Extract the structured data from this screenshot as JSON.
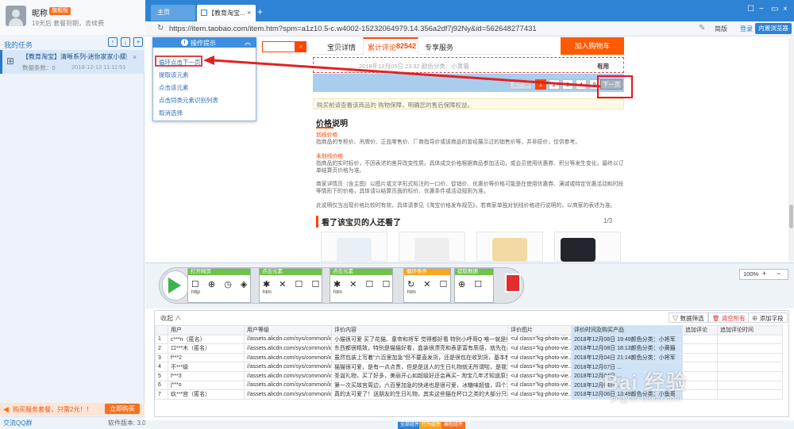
{
  "user": {
    "name": "昵称",
    "vip": "旗舰版",
    "expiry": "19天后 套餐到期，去续费"
  },
  "tasks_panel": {
    "title": "我的任务",
    "tasks": [
      {
        "title": "【教育淘宝】清晰系列-迷你家家小摆架模件...",
        "owner": "数据条数：0",
        "time": "2018-12-12 11:11:51"
      }
    ]
  },
  "promo": {
    "text": "购买服务套餐，只需2元！！",
    "button": "立即购买"
  },
  "footer": {
    "qq": "交流QQ群",
    "version": "软件版本: 3.0.6"
  },
  "browser": {
    "tabs": [
      {
        "label": "主页"
      },
      {
        "label": "【教育淘宝..."
      }
    ],
    "new_tab": "+",
    "window_buttons": [
      "☐",
      "−",
      "▭",
      "×"
    ],
    "url": "https://item.taobao.com/item.htm?spm=a1z10.5-c.w4002-15232064979.14.356a2df7j92Ny&id=562648277431",
    "simple_mode": "简版",
    "login": "登录",
    "builtin_browser": "内置浏览器"
  },
  "page": {
    "tabs": {
      "detail": "宝贝详情",
      "reviews": "累计评论",
      "reviews_count": "82542",
      "service": "专享服务"
    },
    "add_to_cart": "加入购物车",
    "review_meta": "2018年12月05日 23:32    颜色分类：小黄猫",
    "review_useful": "有用",
    "pager": {
      "prev": "上一页",
      "pages": [
        "1",
        "2",
        "3",
        "4",
        "5"
      ],
      "next": "下一页"
    },
    "guarantee_note": "购买前请查看该商品的 购物保障，明确您的售后保障权益。",
    "price_heading": "价格说明",
    "price_sections": [
      {
        "heading": "划线价格",
        "text": "指商品的专柜价、吊牌价、正品零售价、厂商指导价或该商品的曾经展示过的销售价等，并非原价，仅供参考。"
      },
      {
        "heading": "未划线价格",
        "text": "指商品的实时标价，不因表述的差异改变性质。具体成交价格根据商品参加活动，或会员使用优惠券、积分等发生变化，最终以订单结算页价格为准。"
      },
      {
        "heading": "",
        "text": "商家详情页（含主图）以图片或文字形式标注的一口价、促销价、优惠价等价格可能是在使用优惠券、满减或特定优惠活动和时段等情形下的价格，具体请以结算页面的标价、优惠条件或活动规则为准。"
      },
      {
        "heading": "",
        "text": "此说明仅当出现价格比较时有效，具体请参见《淘宝价格发布规范》。若商家单独对划线价格进行说明的，以商家的表述为准。"
      }
    ],
    "also_viewed": "看了该宝贝的人还看了",
    "also_viewed_page": "1/3"
  },
  "popup": {
    "title": "操作提示",
    "items": [
      "循环点击下一页",
      "提取该元素",
      "点击该元素",
      "点击同类元素识别列表",
      "取消选择"
    ]
  },
  "workflow": {
    "steps": [
      {
        "title": "打开网页",
        "icons": "☐ ⊕ ◷ ◈",
        "sub": "http"
      },
      {
        "title": "点击元素",
        "icons": "✱ ✕ ☐ ☐",
        "sub": "htm"
      },
      {
        "title": "点击元素",
        "icons": "✱ ✕ ☐ ☐",
        "sub": "htm"
      },
      {
        "title": "循环条件",
        "icons": "↻ ✕ ☐",
        "sub": "htm"
      },
      {
        "title": "提取数据",
        "icons": "⊕ ☐",
        "sub": ""
      }
    ],
    "zoom": "100%",
    "zoom_in": "+",
    "zoom_out": "−"
  },
  "data_panel": {
    "collapse": "收起 ∧",
    "filter": "数据筛选",
    "clear": "清空所有",
    "add_field": "添加字段",
    "columns": [
      "",
      "用户",
      "用户等级",
      "评价内容",
      "评价图片",
      "评价时间及购买产品",
      "追加评论",
      "追加评论时间"
    ],
    "rows": [
      [
        "1",
        "c***n（匿名）",
        "//assets.alicdn.com/sys/common/ic...",
        "小猫很可爱 买了花猫、童帝和将军 觉得都好看 特别小呼哥Q 唯一就是细节做...",
        "<ul class=\"kg-photo-vie...",
        "2018年12月08日 19:49颜色分类：小将军",
        "",
        ""
      ],
      [
        "2",
        "口***木（匿名）",
        "//assets.alicdn.com/sys/common/ic...",
        "东西都很精致，特别是猫猫好看，盒装很漂亮和表更富有质感，就先在心里种草...",
        "<ul class=\"kg-photo-vie...",
        "2018年12月08日 18:13颜色分类：小黄猫",
        "",
        ""
      ],
      [
        "3",
        "f***2",
        "//assets.alicdn.com/sys/common/ic...",
        "虽然包装上写着\"六百里加急\"但不要直发货，还是很包在收到货，基本都是双...",
        "<ul class=\"kg-photo-vie...",
        "2018年12月04日 21:14颜色分类：小将军",
        "",
        ""
      ],
      [
        "4",
        "不***级",
        "//assets.alicdn.com/sys/common/ic...",
        "猫猫很可爱，是有一点点贵，但是是送人的生日礼物就无所谓啦，是我第一次...",
        "<ul class=\"kg-photo-vie...",
        "2018年12月07日 ...",
        "",
        ""
      ],
      [
        "5",
        "l***3",
        "//assets.alicdn.com/sys/common/ic...",
        "圣诞礼物，买了好多，美丽开心如超级好还会再买~ 淘宝几年才知道原来评论...",
        "<ul class=\"kg-photo-vie...",
        "2018年12月04日 ...",
        "",
        ""
      ],
      [
        "6",
        "j***o",
        "//assets.alicdn.com/sys/common/ic...",
        "第一次买故宫周边，六百里加急的快递也是很可爱，冰糖味超值，四个才卡块...",
        "<ul class=\"kg-photo-vie...",
        "2018年12月04日 ...",
        "",
        ""
      ],
      [
        "7",
        "玖***宫（匿名）",
        "//assets.alicdn.com/sys/common/ic...",
        "真的太可爱了！送朋友的生日礼物，其实这些猫在杯口之类的大部分只能挂在杯子...",
        "<ul class=\"kg-photo-vie...",
        "2018年12月06日 13:49颜色分类：小鱼哥",
        "",
        ""
      ]
    ]
  },
  "bottom_tabs": [
    "全部组件",
    "行为组件",
    "编程组件"
  ],
  "watermark": {
    "brand": "Bai 经验",
    "url": "jingyan.baidu.com"
  },
  "colors": {
    "accent": "#2e83d4",
    "taobao": "#ff4400",
    "start": "#3cb44b",
    "stop": "#e12e2e",
    "highlight": "#e12222"
  }
}
